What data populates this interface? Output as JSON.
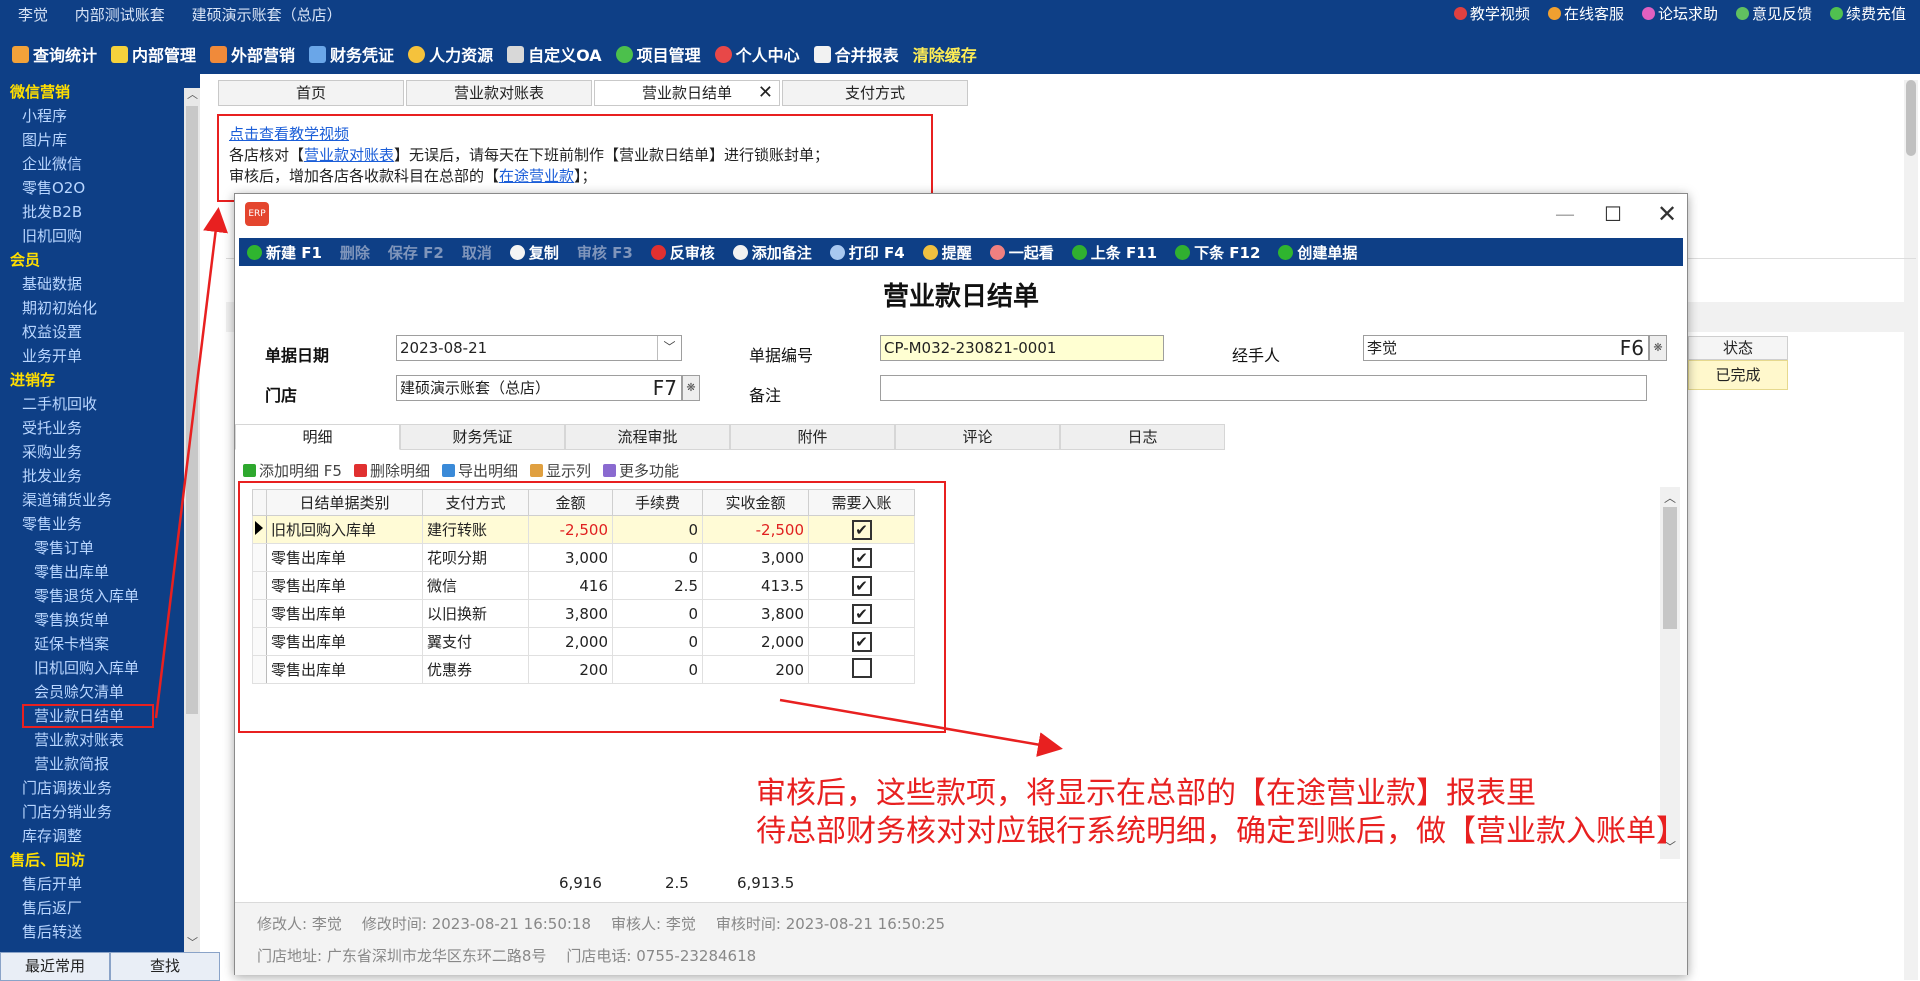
{
  "titlebar": {
    "user": "李觉",
    "account_a": "内部测试账套",
    "account_b": "建硕演示账套（总店）",
    "links": [
      "教学视频",
      "在线客服",
      "论坛求助",
      "意见反馈",
      "续费充值"
    ]
  },
  "menubar": {
    "items": [
      "查询统计",
      "内部管理",
      "外部营销",
      "财务凭证",
      "人力资源",
      "自定义OA",
      "项目管理",
      "个人中心",
      "合并报表"
    ],
    "clear_cache": "清除缓存"
  },
  "sidebar": {
    "items": [
      {
        "label": "微信营销",
        "level": "group"
      },
      {
        "label": "小程序",
        "level": "lvl1"
      },
      {
        "label": "图片库",
        "level": "lvl1"
      },
      {
        "label": "企业微信",
        "level": "lvl1"
      },
      {
        "label": "零售O2O",
        "level": "lvl1"
      },
      {
        "label": "批发B2B",
        "level": "lvl1"
      },
      {
        "label": "旧机回购",
        "level": "lvl1"
      },
      {
        "label": "会员",
        "level": "group"
      },
      {
        "label": "基础数据",
        "level": "lvl1"
      },
      {
        "label": "期初初始化",
        "level": "lvl1"
      },
      {
        "label": "权益设置",
        "level": "lvl1"
      },
      {
        "label": "业务开单",
        "level": "lvl1"
      },
      {
        "label": "进销存",
        "level": "group"
      },
      {
        "label": "二手机回收",
        "level": "lvl1"
      },
      {
        "label": "受托业务",
        "level": "lvl1"
      },
      {
        "label": "采购业务",
        "level": "lvl1"
      },
      {
        "label": "批发业务",
        "level": "lvl1"
      },
      {
        "label": "渠道铺货业务",
        "level": "lvl1"
      },
      {
        "label": "零售业务",
        "level": "lvl1"
      },
      {
        "label": "零售订单",
        "level": "lvl2"
      },
      {
        "label": "零售出库单",
        "level": "lvl2"
      },
      {
        "label": "零售退货入库单",
        "level": "lvl2"
      },
      {
        "label": "零售换货单",
        "level": "lvl2"
      },
      {
        "label": "延保卡档案",
        "level": "lvl2"
      },
      {
        "label": "旧机回购入库单",
        "level": "lvl2"
      },
      {
        "label": "会员赊欠清单",
        "level": "lvl2"
      },
      {
        "label": "营业款日结单",
        "level": "lvl2",
        "active": true
      },
      {
        "label": "营业款对账表",
        "level": "lvl2"
      },
      {
        "label": "营业款简报",
        "level": "lvl2"
      },
      {
        "label": "门店调拨业务",
        "level": "lvl1"
      },
      {
        "label": "门店分销业务",
        "level": "lvl1"
      },
      {
        "label": "库存调整",
        "level": "lvl1"
      },
      {
        "label": "售后、回访",
        "level": "group"
      },
      {
        "label": "售后开单",
        "level": "lvl1"
      },
      {
        "label": "售后返厂",
        "level": "lvl1"
      },
      {
        "label": "售后转送",
        "level": "lvl1"
      }
    ],
    "bottom_tabs": [
      "最近常用",
      "查找"
    ]
  },
  "content_tabs": [
    "首页",
    "营业款对账表",
    "营业款日结单",
    "支付方式"
  ],
  "notice": {
    "video_link": "点击查看教学视频",
    "line1_a": "各店核对【",
    "line1_link": "营业款对账表",
    "line1_b": "】无误后，请每天在下班前制作【营业款日结单】进行锁账封单；",
    "line2_a": "审核后，增加各店各收款科目在总部的【",
    "line2_link": "在途营业款",
    "line2_b": "】；"
  },
  "background_grid": {
    "status_header": "状态",
    "status_value": "已完成"
  },
  "dialog": {
    "logo_text": "ERP",
    "toolbar": [
      {
        "label": "新建 F1",
        "enabled": true,
        "icon": "plus-icon"
      },
      {
        "label": "删除",
        "enabled": false,
        "icon": ""
      },
      {
        "label": "保存 F2",
        "enabled": false,
        "icon": ""
      },
      {
        "label": "取消",
        "enabled": false,
        "icon": ""
      },
      {
        "label": "复制",
        "enabled": true,
        "icon": "copy-icon"
      },
      {
        "label": "审核 F3",
        "enabled": false,
        "icon": ""
      },
      {
        "label": "反审核",
        "enabled": true,
        "icon": "unaudit-icon"
      },
      {
        "label": "添加备注",
        "enabled": true,
        "icon": "note-icon"
      },
      {
        "label": "打印 F4",
        "enabled": true,
        "icon": "printer-icon"
      },
      {
        "label": "提醒",
        "enabled": true,
        "icon": "clock-icon"
      },
      {
        "label": "一起看",
        "enabled": true,
        "icon": "people-icon"
      },
      {
        "label": "上条 F11",
        "enabled": true,
        "icon": "prev-icon"
      },
      {
        "label": "下条 F12",
        "enabled": true,
        "icon": "next-icon"
      },
      {
        "label": "创建单据",
        "enabled": true,
        "icon": "plus-icon"
      }
    ],
    "heading": "营业款日结单",
    "form": {
      "date_label": "单据日期",
      "date_value": "2023-08-21",
      "docno_label": "单据编号",
      "docno_value": "CP-M032-230821-0001",
      "handler_label": "经手人",
      "handler_value": "李觉",
      "handler_key": "F6",
      "store_label": "门店",
      "store_value": "建硕演示账套（总店）",
      "store_key": "F7",
      "remark_label": "备注",
      "remark_value": ""
    },
    "tabs": [
      "明细",
      "财务凭证",
      "流程审批",
      "附件",
      "评论",
      "日志"
    ],
    "detail_toolbar": [
      "添加明细 F5",
      "删除明细",
      "导出明细",
      "显示列",
      "更多功能"
    ],
    "grid": {
      "headers": [
        "日结单据类别",
        "支付方式",
        "金额",
        "手续费",
        "实收金额",
        "需要入账"
      ],
      "rows": [
        {
          "type": "旧机回购入库单",
          "pay": "建行转账",
          "amount": "-2,500",
          "fee": "0",
          "net": "-2,500",
          "check": true,
          "selected": true
        },
        {
          "type": "零售出库单",
          "pay": "花呗分期",
          "amount": "3,000",
          "fee": "0",
          "net": "3,000",
          "check": true
        },
        {
          "type": "零售出库单",
          "pay": "微信",
          "amount": "416",
          "fee": "2.5",
          "net": "413.5",
          "check": true
        },
        {
          "type": "零售出库单",
          "pay": "以旧换新",
          "amount": "3,800",
          "fee": "0",
          "net": "3,800",
          "check": true
        },
        {
          "type": "零售出库单",
          "pay": "翼支付",
          "amount": "2,000",
          "fee": "0",
          "net": "2,000",
          "check": true
        },
        {
          "type": "零售出库单",
          "pay": "优惠券",
          "amount": "200",
          "fee": "0",
          "net": "200",
          "check": false
        }
      ],
      "totals": {
        "amount": "6,916",
        "fee": "2.5",
        "net": "6,913.5"
      }
    },
    "footer": {
      "modifier_label": "修改人:",
      "modifier": "李觉",
      "modtime_label": "修改时间:",
      "modtime": "2023-08-21 16:50:18",
      "auditor_label": "审核人:",
      "auditor": "李觉",
      "audittime_label": "审核时间:",
      "audittime": "2023-08-21 16:50:25",
      "address_label": "门店地址:",
      "address": "广东省深圳市龙华区东环二路8号",
      "phone_label": "门店电话:",
      "phone": "0755-23284618"
    }
  },
  "annotation": {
    "line1": "审核后，这些款项，将显示在总部的【在途营业款】报表里",
    "line2": "待总部财务核对对应银行系统明细，确定到账后，做【营业款入账单】"
  },
  "colors": {
    "brand_blue": "#0e3f86",
    "accent_red": "#e82020",
    "group_yellow": "#ffde00"
  }
}
